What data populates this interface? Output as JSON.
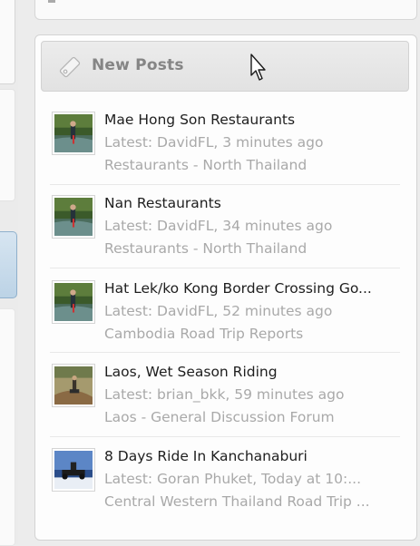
{
  "panel": {
    "title": "New Posts",
    "posts": [
      {
        "title": "Mae Hong Son Restaurants",
        "latest": "Latest: DavidFL, 3 minutes ago",
        "forum": "Restaurants - North Thailand",
        "avatar": "river-avatar"
      },
      {
        "title": "Nan Restaurants",
        "latest": "Latest: DavidFL, 34 minutes ago",
        "forum": "Restaurants - North Thailand",
        "avatar": "river-avatar"
      },
      {
        "title": "Hat Lek/ko Kong Border Crossing Go...",
        "latest": "Latest: DavidFL, 52 minutes ago",
        "forum": "Cambodia Road Trip Reports",
        "avatar": "river-avatar"
      },
      {
        "title": "Laos, Wet Season Riding",
        "latest": "Latest: brian_bkk, 59 minutes ago",
        "forum": "Laos - General Discussion Forum",
        "avatar": "dirt-road-avatar"
      },
      {
        "title": "8 Days Ride In Kanchanaburi",
        "latest": "Latest: Goran Phuket, Today at 10:...",
        "forum": "Central Western Thailand Road Trip ...",
        "avatar": "motorbike-avatar"
      }
    ]
  },
  "colors": {
    "title_text": "#1e1e1e",
    "meta_text": "#a9a9a9",
    "header_text": "#858585",
    "accent_blue": "#bcd3e6"
  },
  "icons": {
    "header": "tag-icon",
    "pointer": "mouse-cursor-icon"
  }
}
